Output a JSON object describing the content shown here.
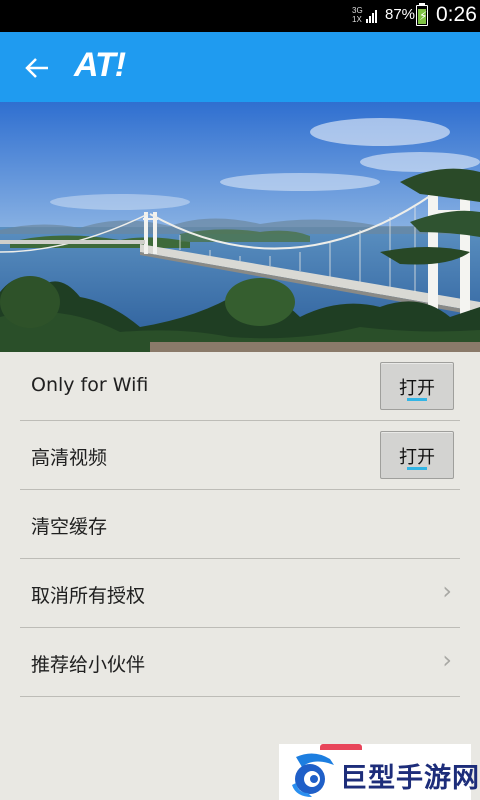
{
  "status_bar": {
    "network_top": "3G",
    "network_bottom": "1X",
    "battery_percent": "87%",
    "battery_level": 0.87,
    "time": "0:26"
  },
  "app_bar": {
    "back_icon": "arrow-left-icon",
    "logo_text": "AT!",
    "color": "#1f9bf0"
  },
  "hero": {
    "description_icon": "bridge-photo"
  },
  "settings": {
    "items": [
      {
        "label": "Only for Wifi",
        "control": "toggle",
        "toggle_text": "打开",
        "toggle_on": true
      },
      {
        "label": "高清视频",
        "control": "toggle",
        "toggle_text": "打开",
        "toggle_on": true
      },
      {
        "label": "清空缓存",
        "control": "none"
      },
      {
        "label": "取消所有授权",
        "control": "chevron",
        "chevron": "›"
      },
      {
        "label": "推荐给小伙伴",
        "control": "chevron",
        "chevron": "›"
      }
    ]
  },
  "watermark": {
    "text": "巨型手游网"
  },
  "colors": {
    "background": "#e9e8e3",
    "accent": "#1f9bf0",
    "toggle_indicator": "#33b5e5"
  }
}
